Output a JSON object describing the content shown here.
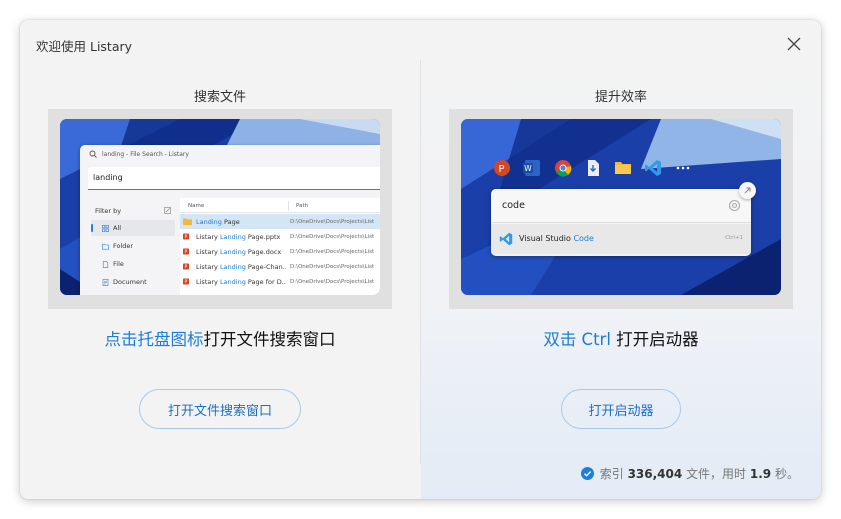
{
  "window": {
    "title": "欢迎使用 Listary"
  },
  "colors": {
    "accent": "#1b7ed4",
    "button_border": "#a8c9ea",
    "check": "#1e7fd8"
  },
  "left": {
    "title": "搜索文件",
    "caption_highlight": "点击托盘图标",
    "caption_rest": "打开文件搜索窗口",
    "button_label": "打开文件搜索窗口",
    "mock": {
      "window_title": "landing - File Search - Listary",
      "query": "landing",
      "filter_label": "Filter by",
      "filters": [
        "All",
        "Folder",
        "File",
        "Document"
      ],
      "columns": [
        "Name",
        "Path"
      ],
      "rows": [
        {
          "pre": "",
          "match": "Landing",
          "post": " Page",
          "path": "D:\\OneDrive\\Docs\\Projects\\List",
          "icon": "folder-icon"
        },
        {
          "pre": "Listary ",
          "match": "Landing",
          "post": " Page.pptx",
          "path": "D:\\OneDrive\\Docs\\Projects\\List",
          "icon": "pptx-icon"
        },
        {
          "pre": "Listary ",
          "match": "Landing",
          "post": " Page.docx",
          "path": "D:\\OneDrive\\Docs\\Projects\\List",
          "icon": "pptx-icon"
        },
        {
          "pre": "Listary ",
          "match": "Landing",
          "post": " Page-Chan...",
          "path": "D:\\OneDrive\\Docs\\Projects\\List",
          "icon": "pptx-icon"
        },
        {
          "pre": "Listary ",
          "match": "Landing",
          "post": " Page for D...",
          "path": "D:\\OneDrive\\Docs\\Projects\\List",
          "icon": "pptx-icon"
        }
      ]
    }
  },
  "right": {
    "title": "提升效率",
    "caption_highlight": "双击 Ctrl",
    "caption_rest": " 打开启动器",
    "button_label": "打开启动器",
    "mock": {
      "query": "code",
      "result_pre": "Visual Studio ",
      "result_match": "Code",
      "shortcut": "Ctrl+1",
      "dock_icons": [
        "powerpoint-icon",
        "word-icon",
        "chrome-icon",
        "installer-icon",
        "folder-icon",
        "vscode-icon",
        "more-icon"
      ]
    }
  },
  "status": {
    "prefix": "索引",
    "count": "336,404",
    "mid": "文件，用时",
    "time": "1.9",
    "suffix": "秒。"
  }
}
